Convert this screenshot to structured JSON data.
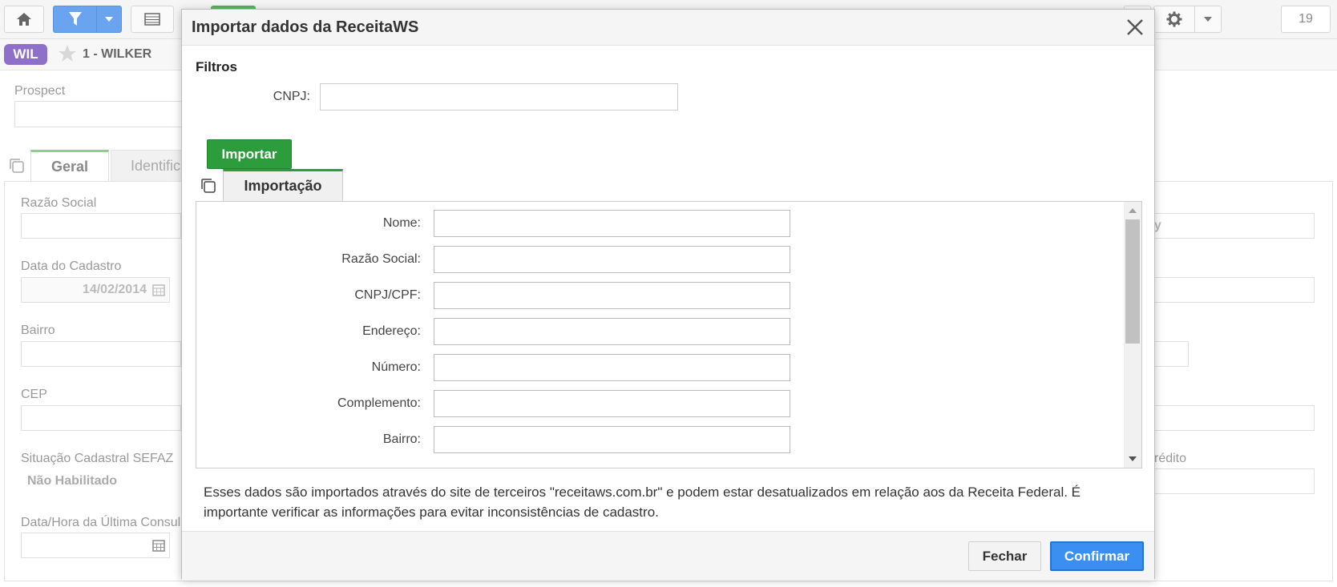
{
  "toolbar": {
    "home_icon": "home-icon",
    "filter_icon": "filter-icon",
    "list_icon": "list-icon",
    "gear_icon": "gear-icon",
    "count": "19"
  },
  "record": {
    "badge": "WIL",
    "title": "1 - WILKER"
  },
  "background_form": {
    "prospect_label": "Prospect",
    "tabs": [
      {
        "label": "Geral"
      },
      {
        "label": "Identific"
      }
    ],
    "razao_social_label": "Razão Social",
    "data_cadastro_label": "Data do Cadastro",
    "data_cadastro_value": "14/02/2014",
    "bairro_label": "Bairro",
    "cep_label": "CEP",
    "situacao_label": "Situação Cadastral SEFAZ",
    "situacao_value": "Não Habilitado",
    "data_hora_label": "Data/Hora da Última Consul",
    "right_partial_value": "ey",
    "right_partial_label": "rédito"
  },
  "modal": {
    "title": "Importar dados da ReceitaWS",
    "filters_heading": "Filtros",
    "cnpj_label": "CNPJ:",
    "cnpj_value": "",
    "import_button": "Importar",
    "tab_label": "Importação",
    "fields": [
      {
        "label": "Nome:",
        "value": ""
      },
      {
        "label": "Razão Social:",
        "value": ""
      },
      {
        "label": "CNPJ/CPF:",
        "value": ""
      },
      {
        "label": "Endereço:",
        "value": ""
      },
      {
        "label": "Número:",
        "value": ""
      },
      {
        "label": "Complemento:",
        "value": ""
      },
      {
        "label": "Bairro:",
        "value": ""
      }
    ],
    "disclaimer": "Esses dados são importados através do site de terceiros \"receitaws.com.br\" e podem estar desatualizados em relação aos da Receita Federal. É importante verificar as informações para evitar inconsistências de cadastro.",
    "close_button": "Fechar",
    "confirm_button": "Confirmar"
  },
  "colors": {
    "import_green": "#2d9c3c",
    "confirm_blue": "#3b8ff0",
    "badge_purple": "#8e6fc9",
    "filter_blue": "#6aa4ef"
  }
}
